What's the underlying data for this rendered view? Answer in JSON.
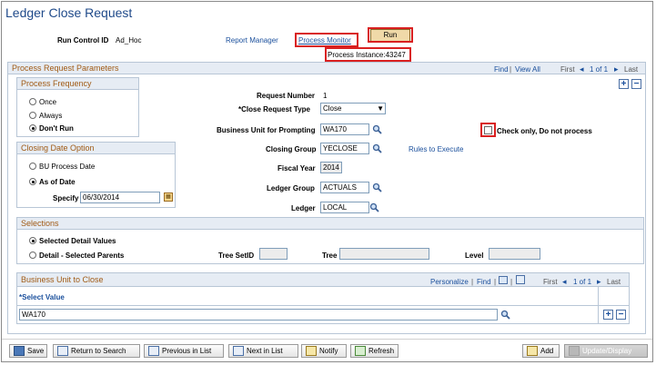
{
  "page_title": "Ledger Close Request",
  "header": {
    "run_control_label": "Run Control ID",
    "run_control_value": "Ad_Hoc",
    "report_manager": "Report Manager",
    "process_monitor": "Process Monitor",
    "run_button": "Run",
    "process_instance": "Process Instance:43247"
  },
  "params": {
    "title": "Process Request Parameters",
    "find": "Find",
    "view_all": "View All",
    "first": "First",
    "range": "1 of 1",
    "last": "Last"
  },
  "frequency": {
    "title": "Process Frequency",
    "options": [
      "Once",
      "Always",
      "Don't Run"
    ],
    "selected": "Don't Run"
  },
  "closing_date": {
    "title": "Closing Date Option",
    "options": [
      "BU Process Date",
      "As of Date"
    ],
    "selected": "As of Date",
    "specify_label": "Specify",
    "specify_value": "06/30/2014"
  },
  "fields": {
    "request_number_label": "Request Number",
    "request_number_value": "1",
    "close_type_label": "*Close Request Type",
    "close_type_value": "Close",
    "bu_prompt_label": "Business Unit for Prompting",
    "bu_prompt_value": "WA170",
    "closing_group_label": "Closing Group",
    "closing_group_value": "YECLOSE",
    "rules_link": "Rules to Execute",
    "fiscal_year_label": "Fiscal Year",
    "fiscal_year_value": "2014",
    "ledger_group_label": "Ledger Group",
    "ledger_group_value": "ACTUALS",
    "ledger_label": "Ledger",
    "ledger_value": "LOCAL",
    "check_only_label": "Check only, Do not process"
  },
  "selections": {
    "title": "Selections",
    "options": [
      "Selected Detail Values",
      "Detail - Selected Parents"
    ],
    "selected": "Selected Detail Values",
    "tree_setid_label": "Tree SetID",
    "tree_label": "Tree",
    "level_label": "Level"
  },
  "bu_close": {
    "title": "Business Unit to Close",
    "personalize": "Personalize",
    "find": "Find",
    "first": "First",
    "range": "1 of 1",
    "last": "Last",
    "column": "*Select Value",
    "row_value": "WA170"
  },
  "toolbar": {
    "save": "Save",
    "return": "Return to Search",
    "previous": "Previous in List",
    "next": "Next in List",
    "notify": "Notify",
    "refresh": "Refresh",
    "add": "Add",
    "update": "Update/Display"
  },
  "colors": {
    "header_text": "#1f4a8a",
    "section_title": "#a05a14",
    "highlight": "#d92020",
    "run_button": "#f0d9a8"
  }
}
